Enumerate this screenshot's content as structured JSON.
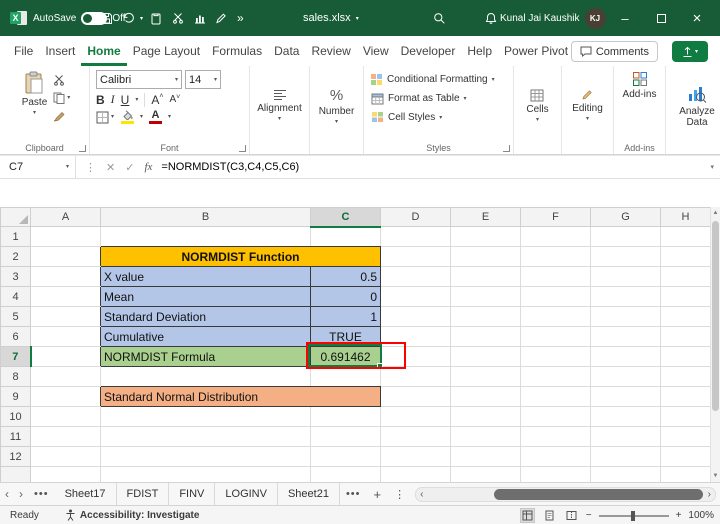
{
  "titlebar": {
    "autosave_label": "AutoSave",
    "autosave_state": "Off",
    "filename": "sales.xlsx",
    "user_name": "Kunal Jai Kaushik",
    "user_initials": "KJ"
  },
  "ribbon": {
    "tabs": [
      {
        "label": "File"
      },
      {
        "label": "Insert"
      },
      {
        "label": "Home"
      },
      {
        "label": "Page Layout"
      },
      {
        "label": "Formulas"
      },
      {
        "label": "Data"
      },
      {
        "label": "Review"
      },
      {
        "label": "View"
      },
      {
        "label": "Developer"
      },
      {
        "label": "Help"
      },
      {
        "label": "Power Pivot"
      }
    ],
    "active_tab": "Home",
    "comments_label": "Comments",
    "paste_label": "Paste",
    "clipboard_group_label": "Clipboard",
    "font_family": "Calibri",
    "font_size": "14",
    "bold": "B",
    "italic": "I",
    "underline": "U",
    "font_group_label": "Font",
    "alignment_label": "Alignment",
    "number_label": "Number",
    "percent_symbol": "%",
    "conditional_formatting_label": "Conditional Formatting",
    "format_as_table_label": "Format as Table",
    "cell_styles_label": "Cell Styles",
    "styles_group_label": "Styles",
    "cells_label": "Cells",
    "editing_label": "Editing",
    "addins_label": "Add-ins",
    "addins_group_label": "Add-ins",
    "analyze_data_label": "Analyze Data"
  },
  "formula_bar": {
    "name_box": "C7",
    "fx_label": "fx",
    "formula": "=NORMDIST(C3,C4,C5,C6)"
  },
  "grid": {
    "col_headers": [
      "A",
      "B",
      "C",
      "D",
      "E",
      "F",
      "G",
      "H"
    ],
    "row_headers": [
      "1",
      "2",
      "3",
      "4",
      "5",
      "6",
      "7",
      "8",
      "9",
      "10",
      "11",
      "12"
    ],
    "selected_cell": "C7",
    "cells": {
      "title": "NORMDIST Function",
      "x_value_label": "X value",
      "x_value": "0.5",
      "mean_label": "Mean",
      "mean": "0",
      "std_dev_label": "Standard Deviation",
      "std_dev": "1",
      "cumulative_label": "Cumulative",
      "cumulative": "TRUE",
      "formula_label": "NORMDIST Formula",
      "formula_result": "0.691462",
      "footer_label": "Standard Normal Distribution"
    }
  },
  "sheet_tabs": {
    "tabs": [
      {
        "label": "Sheet17"
      },
      {
        "label": "FDIST"
      },
      {
        "label": "FINV"
      },
      {
        "label": "LOGINV"
      },
      {
        "label": "Sheet21"
      }
    ]
  },
  "status_bar": {
    "ready_label": "Ready",
    "accessibility_label": "Accessibility: Investigate",
    "zoom_level": "100%"
  },
  "colors": {
    "titlebar_green": "#185C37",
    "accent_green": "#107C41",
    "header_fill_gold": "#FFC000",
    "input_fill_blue": "#B4C6E7",
    "result_fill_green": "#A9D08E",
    "footer_fill_orange": "#F4B084",
    "annotation_red": "#FF0000"
  }
}
